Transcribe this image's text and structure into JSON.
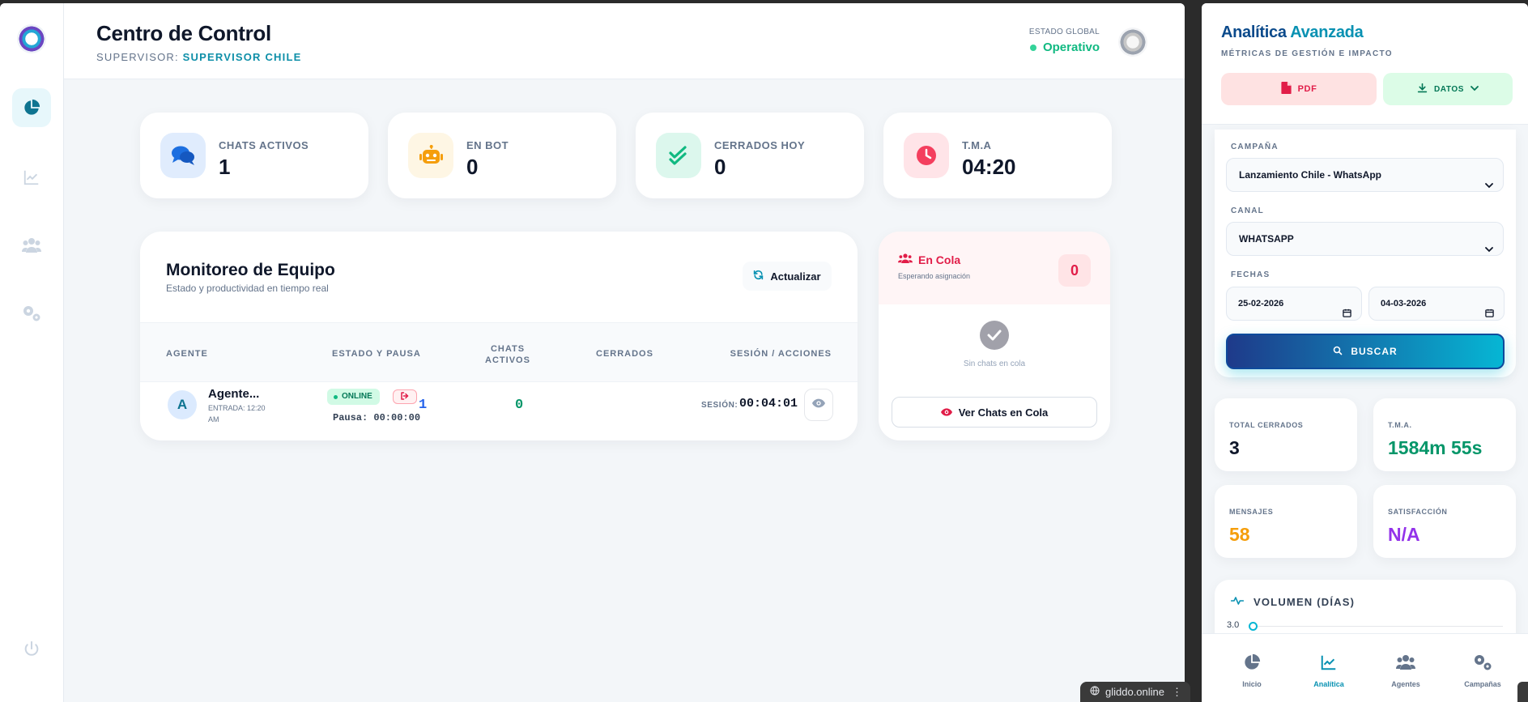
{
  "left": {
    "rail": {
      "icons": [
        "logo",
        "pie-chart-icon",
        "line-chart-icon",
        "users-icon",
        "gears-icon",
        "power-icon"
      ]
    },
    "header": {
      "title": "Centro de Control",
      "supervisor_label": "SUPERVISOR:",
      "supervisor_value": "SUPERVISOR CHILE",
      "estado_label": "ESTADO GLOBAL",
      "estado_value": "Operativo"
    },
    "stats": [
      {
        "label": "CHATS ACTIVOS",
        "value": "1",
        "icon": "comments-icon",
        "color": "#1d6fe0"
      },
      {
        "label": "EN BOT",
        "value": "0",
        "icon": "robot-icon",
        "color": "#f59e0b"
      },
      {
        "label": "CERRADOS HOY",
        "value": "0",
        "icon": "double-check-icon",
        "color": "#10b981"
      },
      {
        "label": "T.M.A",
        "value": "04:20",
        "icon": "clock-icon",
        "color": "#f43f5e"
      }
    ],
    "team": {
      "title": "Monitoreo de Equipo",
      "subtitle": "Estado y productividad en tiempo real",
      "refresh_label": "Actualizar",
      "columns": [
        "AGENTE",
        "ESTADO Y PAUSA",
        "CHATS ACTIVOS",
        "CERRADOS",
        "SESIÓN / ACCIONES"
      ],
      "rows": [
        {
          "initial": "A",
          "name": "Agente...",
          "entrada": "ENTRADA: 12:20 AM",
          "status": "ONLINE",
          "pausa": "Pausa: 00:00:00",
          "chats": "1",
          "cerrados": "0",
          "sesion_label": "SESIÓN:",
          "sesion": "00:04:01"
        }
      ]
    },
    "queue": {
      "title": "En Cola",
      "subtitle": "Esperando asignación",
      "count": "0",
      "empty": "Sin chats en cola",
      "button": "Ver Chats en Cola"
    }
  },
  "right": {
    "title_a": "Analítica",
    "title_b": "Avanzada",
    "subtitle": "MÉTRICAS DE GESTIÓN E IMPACTO",
    "pdf_label": "PDF",
    "datos_label": "DATOS",
    "filters": {
      "campana_label": "CAMPAÑA",
      "campana_value": "Lanzamiento Chile - WhatsApp",
      "canal_label": "CANAL",
      "canal_value": "WHATSAPP",
      "fechas_label": "FECHAS",
      "fecha_desde": "25-02-2026",
      "fecha_hasta": "04-03-2026",
      "buscar_label": "BUSCAR"
    },
    "kpis": [
      {
        "label": "TOTAL CERRADOS",
        "value": "3",
        "color": "#0f172a"
      },
      {
        "label": "T.M.A.",
        "value": "1584m 55s",
        "color": "#059669"
      },
      {
        "label": "MENSAJES",
        "value": "58",
        "color": "#f59e0b"
      },
      {
        "label": "SATISFACCIÓN",
        "value": "N/A",
        "color": "#9333ea"
      }
    ],
    "volumen": {
      "title": "VOLUMEN (DÍAS)",
      "y_tick": "3.0"
    },
    "tabs": [
      {
        "label": "Inicio",
        "icon": "pie-chart-icon"
      },
      {
        "label": "Analítica",
        "icon": "line-chart-icon",
        "active": true
      },
      {
        "label": "Agentes",
        "icon": "users-icon"
      },
      {
        "label": "Campañas",
        "icon": "gears-icon"
      }
    ]
  },
  "browser": {
    "domain": "gliddo.online"
  }
}
